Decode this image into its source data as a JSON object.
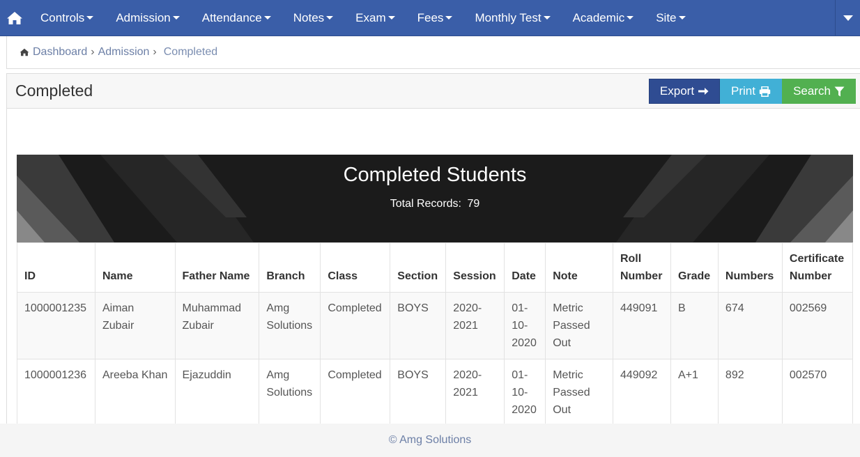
{
  "nav": {
    "items": [
      {
        "label": "Controls"
      },
      {
        "label": "Admission"
      },
      {
        "label": "Attendance"
      },
      {
        "label": "Notes"
      },
      {
        "label": "Exam"
      },
      {
        "label": "Fees"
      },
      {
        "label": "Monthly Test"
      },
      {
        "label": "Academic"
      },
      {
        "label": "Site"
      }
    ],
    "home_icon": "home-icon",
    "right_icon": "caret-down-icon"
  },
  "breadcrumb": {
    "home": "Dashboard",
    "section": "Admission",
    "current": "Completed"
  },
  "panel": {
    "title": "Completed",
    "buttons": {
      "export": "Export",
      "print": "Print",
      "search": "Search"
    }
  },
  "banner": {
    "title": "Completed Students",
    "records_label": "Total Records:",
    "records_count": "79"
  },
  "table": {
    "headers": [
      "ID",
      "Name",
      "Father Name",
      "Branch",
      "Class",
      "Section",
      "Session",
      "Date",
      "Note",
      "Roll Number",
      "Grade",
      "Numbers",
      "Certificate Number"
    ],
    "rows": [
      [
        "1000001235",
        "Aiman Zubair",
        "Muhammad Zubair",
        "Amg Solutions",
        "Completed",
        "BOYS",
        "2020-2021",
        "01-10-2020",
        "Metric Passed Out",
        "449091",
        "B",
        "674",
        "002569"
      ],
      [
        "1000001236",
        "Areeba Khan",
        "Ejazuddin",
        "Amg Solutions",
        "Completed",
        "BOYS",
        "2020-2021",
        "01-10-2020",
        "Metric Passed Out",
        "449092",
        "A+1",
        "892",
        "002570"
      ]
    ]
  },
  "footer": {
    "text": "© Amg Solutions"
  },
  "colors": {
    "nav_bg": "#3a5ea8",
    "export_btn": "#2f4c92",
    "print_btn": "#41b0d6",
    "search_btn": "#52b050",
    "banner_bg": "#1b1b1b"
  }
}
